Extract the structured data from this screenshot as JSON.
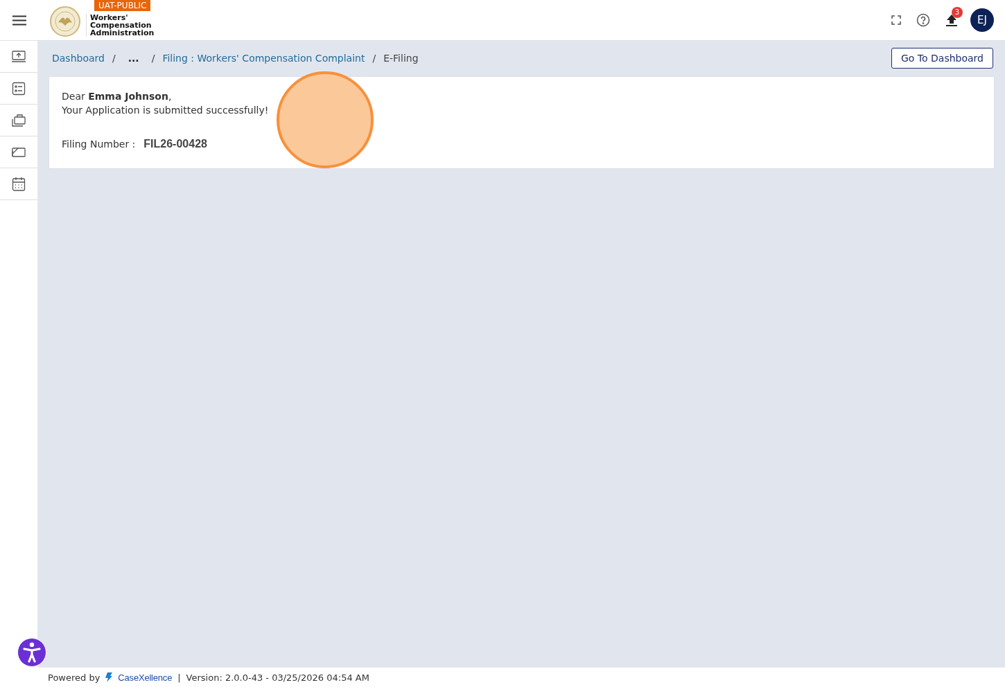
{
  "header": {
    "env_badge": "UAT-PUBLIC",
    "org_name": "Workers' Compensation Administration",
    "upload_count": "3",
    "avatar_initials": "EJ"
  },
  "breadcrumb": [
    {
      "label": "Dashboard",
      "kind": "link"
    },
    {
      "separator": "/",
      "label": "...",
      "kind": "ellipsis"
    },
    {
      "separator": "/",
      "label": "Filing : Workers' Compensation Complaint",
      "kind": "link"
    },
    {
      "separator": "/",
      "label": "E-Filing",
      "kind": "current"
    }
  ],
  "go_button": "Go To Dashboard",
  "message": {
    "greeting": "Dear **Emma Johnson**,",
    "text": "Your Application is submitted successfully!",
    "filing_label": "Filing Number :",
    "filing_number": "FIL26-00428"
  },
  "footer": {
    "powered_by": "Powered by",
    "brand": "CaseXellence",
    "separator": "|",
    "version": "Version: 2.0.0-43 - 03/25/2026 04:54 AM"
  }
}
